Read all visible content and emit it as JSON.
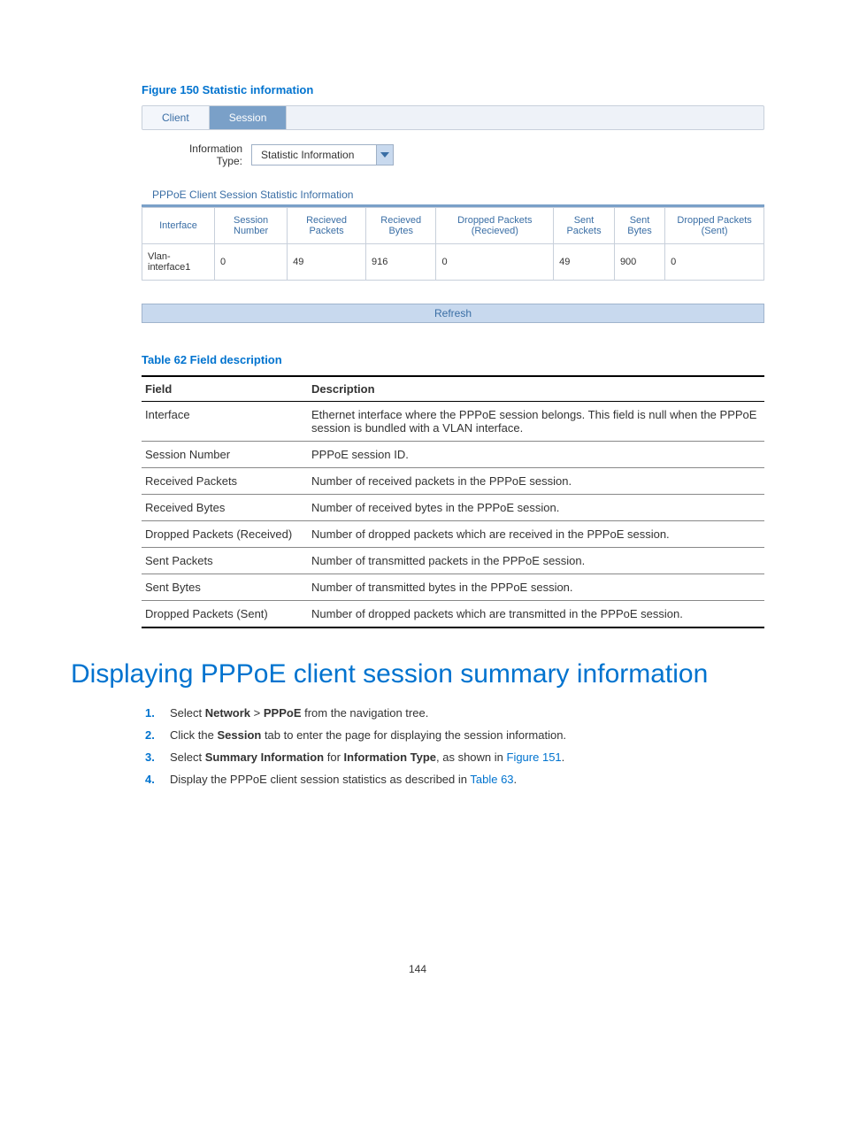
{
  "figure_caption": "Figure 150 Statistic information",
  "tabs": {
    "client": "Client",
    "session": "Session"
  },
  "info_type": {
    "label": "Information Type:",
    "value": "Statistic Information"
  },
  "section_title": "PPPoE Client Session Statistic Information",
  "stats_headers": [
    "Interface",
    "Session Number",
    "Recieved Packets",
    "Recieved Bytes",
    "Dropped Packets (Recieved)",
    "Sent Packets",
    "Sent Bytes",
    "Dropped Packets (Sent)"
  ],
  "stats_row": [
    "Vlan-interface1",
    "0",
    "49",
    "916",
    "0",
    "49",
    "900",
    "0"
  ],
  "refresh_label": "Refresh",
  "table_caption": "Table 62 Field description",
  "desc_headers": {
    "field": "Field",
    "desc": "Description"
  },
  "desc_rows": [
    {
      "field": "Interface",
      "desc": "Ethernet interface where the PPPoE session belongs. This field is null when the PPPoE session is bundled with a VLAN interface."
    },
    {
      "field": "Session Number",
      "desc": "PPPoE session ID."
    },
    {
      "field": "Received Packets",
      "desc": "Number of received packets in the PPPoE session."
    },
    {
      "field": "Received Bytes",
      "desc": "Number of received bytes in the PPPoE session."
    },
    {
      "field": "Dropped Packets (Received)",
      "desc": "Number of dropped packets which are received in the PPPoE session."
    },
    {
      "field": "Sent Packets",
      "desc": "Number of transmitted packets in the PPPoE session."
    },
    {
      "field": "Sent Bytes",
      "desc": "Number of transmitted bytes in the PPPoE session."
    },
    {
      "field": "Dropped Packets (Sent)",
      "desc": "Number of dropped packets which are transmitted in the PPPoE session."
    }
  ],
  "heading": "Displaying PPPoE client session summary information",
  "steps": {
    "s1_a": "Select ",
    "s1_b": "Network",
    "s1_c": " > ",
    "s1_d": "PPPoE",
    "s1_e": " from the navigation tree.",
    "s2_a": "Click the ",
    "s2_b": "Session",
    "s2_c": " tab to enter the page for displaying the session information.",
    "s3_a": "Select ",
    "s3_b": "Summary Information",
    "s3_c": " for ",
    "s3_d": "Information Type",
    "s3_e": ", as shown in ",
    "s3_f": "Figure 151",
    "s3_g": ".",
    "s4_a": "Display the PPPoE client session statistics as described in ",
    "s4_b": "Table 63",
    "s4_c": "."
  },
  "page_number": "144"
}
